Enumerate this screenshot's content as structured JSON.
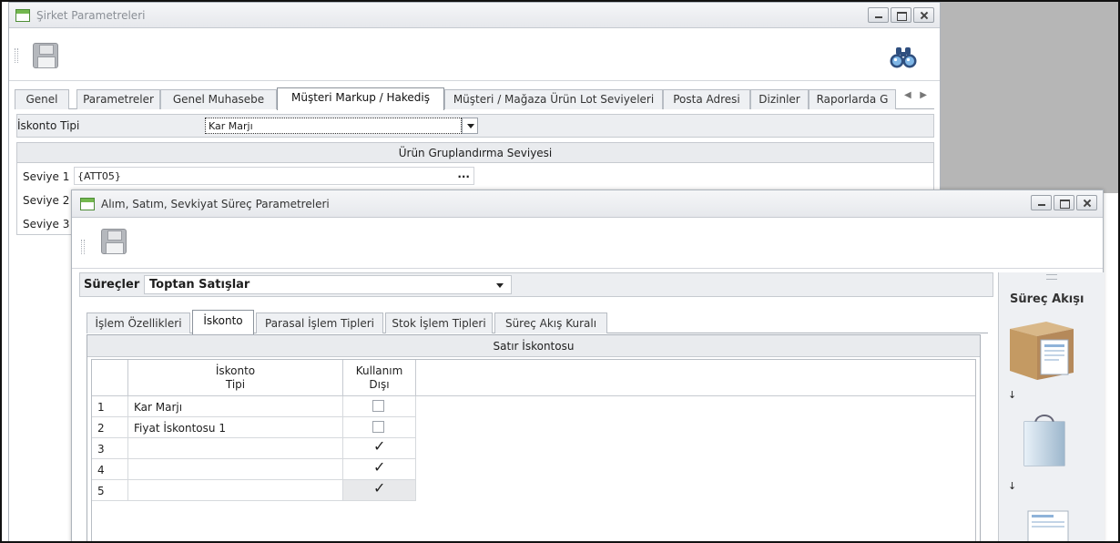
{
  "window1": {
    "title": "Şirket Parametreleri",
    "tabs": [
      {
        "label": "Genel"
      },
      {
        "label": "Parametreler"
      },
      {
        "label": "Genel Muhasebe"
      },
      {
        "label": "Müşteri Markup / Hakediş"
      },
      {
        "label": "Müşteri / Mağaza Ürün Lot Seviyeleri"
      },
      {
        "label": "Posta Adresi"
      },
      {
        "label": "Dizinler"
      },
      {
        "label": "Raporlarda G"
      }
    ],
    "iskonto_tipi_label": "İskonto Tipi",
    "iskonto_tipi_value": "Kar Marjı",
    "group_title": "Ürün Gruplandırma Seviyesi",
    "seviye": [
      {
        "label": "Seviye 1",
        "value": "{ATT05}"
      },
      {
        "label": "Seviye 2"
      },
      {
        "label": "Seviye 3"
      }
    ],
    "ellipsis": "..."
  },
  "window2": {
    "title": "Alım, Satım, Sevkiyat Süreç Parametreleri",
    "surecler_label": "Süreçler",
    "surecler_value": "Toptan Satışlar",
    "tabs": [
      {
        "label": "İşlem Özellikleri"
      },
      {
        "label": "İskonto"
      },
      {
        "label": "Parasal İşlem Tipleri"
      },
      {
        "label": "Stok İşlem Tipleri"
      },
      {
        "label": "Süreç Akış Kuralı"
      }
    ],
    "panel_title": "Satır İskontosu",
    "grid": {
      "col_tipi_line1": "İskonto",
      "col_tipi_line2": "Tipi",
      "col_dis_line1": "Kullanım",
      "col_dis_line2": "Dışı",
      "rows": [
        {
          "no": "1",
          "tipi": "Kar Marjı",
          "disi": false
        },
        {
          "no": "2",
          "tipi": "Fiyat İskontosu 1",
          "disi": false
        },
        {
          "no": "3",
          "tipi": "",
          "disi": true
        },
        {
          "no": "4",
          "tipi": "",
          "disi": true
        },
        {
          "no": "5",
          "tipi": "",
          "disi": true
        }
      ]
    },
    "side_title": "Süreç Akışı",
    "flow_arrow": "↓"
  }
}
